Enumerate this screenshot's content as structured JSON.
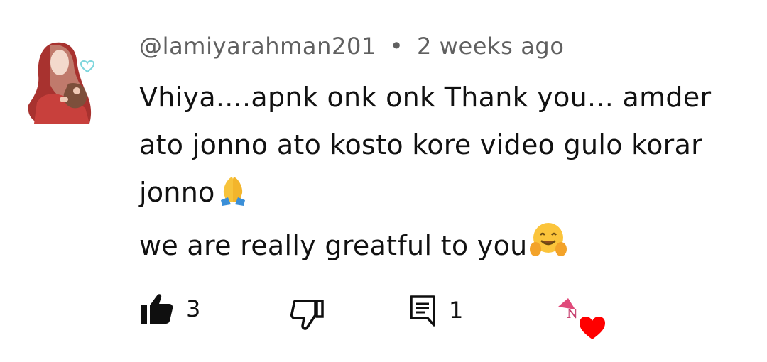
{
  "comment": {
    "author": "@lamiyarahman201",
    "separator": "•",
    "time": "2 weeks ago",
    "lines": [
      "Vhiya....apnk onk onk Thank  you... amder",
      "ato jonno ato kosto kore video gulo korar",
      "jonno",
      "we are really greatful to you"
    ],
    "line_emojis": [
      "",
      "",
      "folded-hands-emoji",
      "hugging-face-emoji"
    ]
  },
  "actions": {
    "like_count": "3",
    "reply_count": "1",
    "like_icon": "thumbs-up-icon",
    "dislike_icon": "thumbs-down-icon",
    "reply_icon": "comment-icon",
    "creator_heart_icon": "creator-heart-icon"
  },
  "creator_heart": {
    "letter": "N",
    "heart_color": "#ff0000"
  }
}
